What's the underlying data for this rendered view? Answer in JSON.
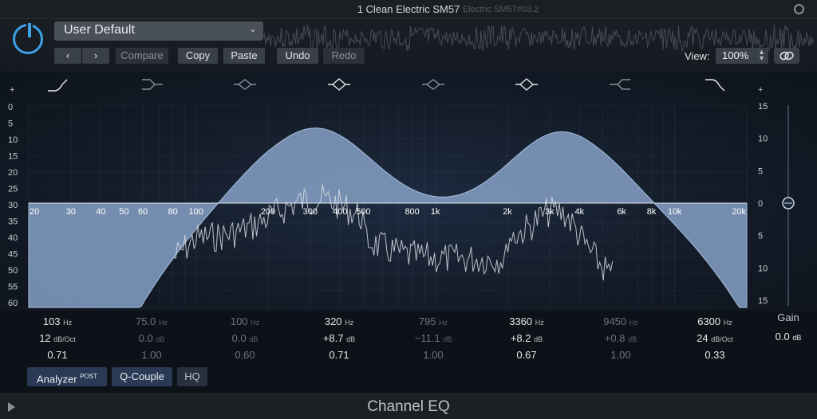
{
  "window": {
    "title": "1 Clean Electric SM57",
    "title_ghost": "Electric SM57#03.2"
  },
  "preset": {
    "name": "User Default"
  },
  "toolbar": {
    "compare": "Compare",
    "copy": "Copy",
    "paste": "Paste",
    "undo": "Undo",
    "redo": "Redo",
    "view_label": "View:",
    "view_value": "100%"
  },
  "graph": {
    "plus_left": "+",
    "plus_right": "+",
    "left_scale": [
      "0",
      "5",
      "10",
      "15",
      "20",
      "25",
      "30",
      "35",
      "40",
      "45",
      "50",
      "55",
      "60"
    ],
    "right_scale": [
      "15",
      "10",
      "5",
      "0",
      "5",
      "10",
      "15"
    ],
    "freq_labels": [
      "20",
      "30",
      "40",
      "50",
      "60",
      "80",
      "100",
      "200",
      "300",
      "400",
      "500",
      "800",
      "1k",
      "2k",
      "3k",
      "4k",
      "6k",
      "8k",
      "10k",
      "20k"
    ]
  },
  "bands": [
    {
      "freq": "103",
      "unit": "Hz",
      "line2": "12",
      "unit2": "dB/Oct",
      "q": "0.71",
      "active": true
    },
    {
      "freq": "75.0",
      "unit": "Hz",
      "line2": "0.0",
      "unit2": "dB",
      "q": "1.00",
      "active": false
    },
    {
      "freq": "100",
      "unit": "Hz",
      "line2": "0.0",
      "unit2": "dB",
      "q": "0.60",
      "active": false
    },
    {
      "freq": "320",
      "unit": "Hz",
      "line2": "+8.7",
      "unit2": "dB",
      "q": "0.71",
      "active": true
    },
    {
      "freq": "795",
      "unit": "Hz",
      "line2": "−11.1",
      "unit2": "dB",
      "q": "1.00",
      "active": false
    },
    {
      "freq": "3360",
      "unit": "Hz",
      "line2": "+8.2",
      "unit2": "dB",
      "q": "0.67",
      "active": true
    },
    {
      "freq": "9450",
      "unit": "Hz",
      "line2": "+0.8",
      "unit2": "dB",
      "q": "1.00",
      "active": false
    },
    {
      "freq": "6300",
      "unit": "Hz",
      "line2": "24",
      "unit2": "dB/Oct",
      "q": "0.33",
      "active": true
    }
  ],
  "gain": {
    "label": "Gain",
    "value": "0.0",
    "unit": "dB"
  },
  "bottom": {
    "analyzer": "Analyzer",
    "analyzer_sup": "POST",
    "qcouple": "Q-Couple",
    "hq": "HQ"
  },
  "footer": {
    "name": "Channel EQ"
  },
  "colors": {
    "accent": "#3ea2e8",
    "curve_fill": "#7f9cc4"
  }
}
